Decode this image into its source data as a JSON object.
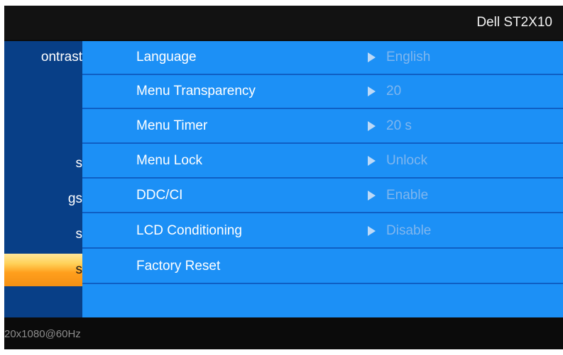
{
  "header": {
    "model": "Dell ST2X10"
  },
  "sidebar": {
    "items": [
      {
        "label": "ontrast",
        "selected": false
      },
      {
        "label": "",
        "selected": false
      },
      {
        "label": "",
        "selected": false
      },
      {
        "label": "s",
        "selected": false
      },
      {
        "label": "gs",
        "selected": false
      },
      {
        "label": "s",
        "selected": false
      },
      {
        "label": "s",
        "selected": true
      },
      {
        "label": "",
        "selected": false
      }
    ]
  },
  "menu": {
    "rows": [
      {
        "label": "Language",
        "value": "English",
        "has_arrow": true
      },
      {
        "label": "Menu Transparency",
        "value": "20",
        "has_arrow": true
      },
      {
        "label": "Menu Timer",
        "value": "20 s",
        "has_arrow": true
      },
      {
        "label": "Menu Lock",
        "value": "Unlock",
        "has_arrow": true
      },
      {
        "label": "DDC/CI",
        "value": "Enable",
        "has_arrow": true
      },
      {
        "label": "LCD Conditioning",
        "value": "Disable",
        "has_arrow": true
      },
      {
        "label": "Factory Reset",
        "value": "",
        "has_arrow": false
      },
      {
        "label": "",
        "value": "",
        "has_arrow": false
      }
    ]
  },
  "footer": {
    "resolution": "20x1080@60Hz"
  },
  "colors": {
    "panel_blue": "#1c90f6",
    "sidebar_navy": "#083f87",
    "selected_orange": "#f49014",
    "header_black": "#121212"
  },
  "icons": {
    "row_arrow": "play-arrow-icon"
  }
}
